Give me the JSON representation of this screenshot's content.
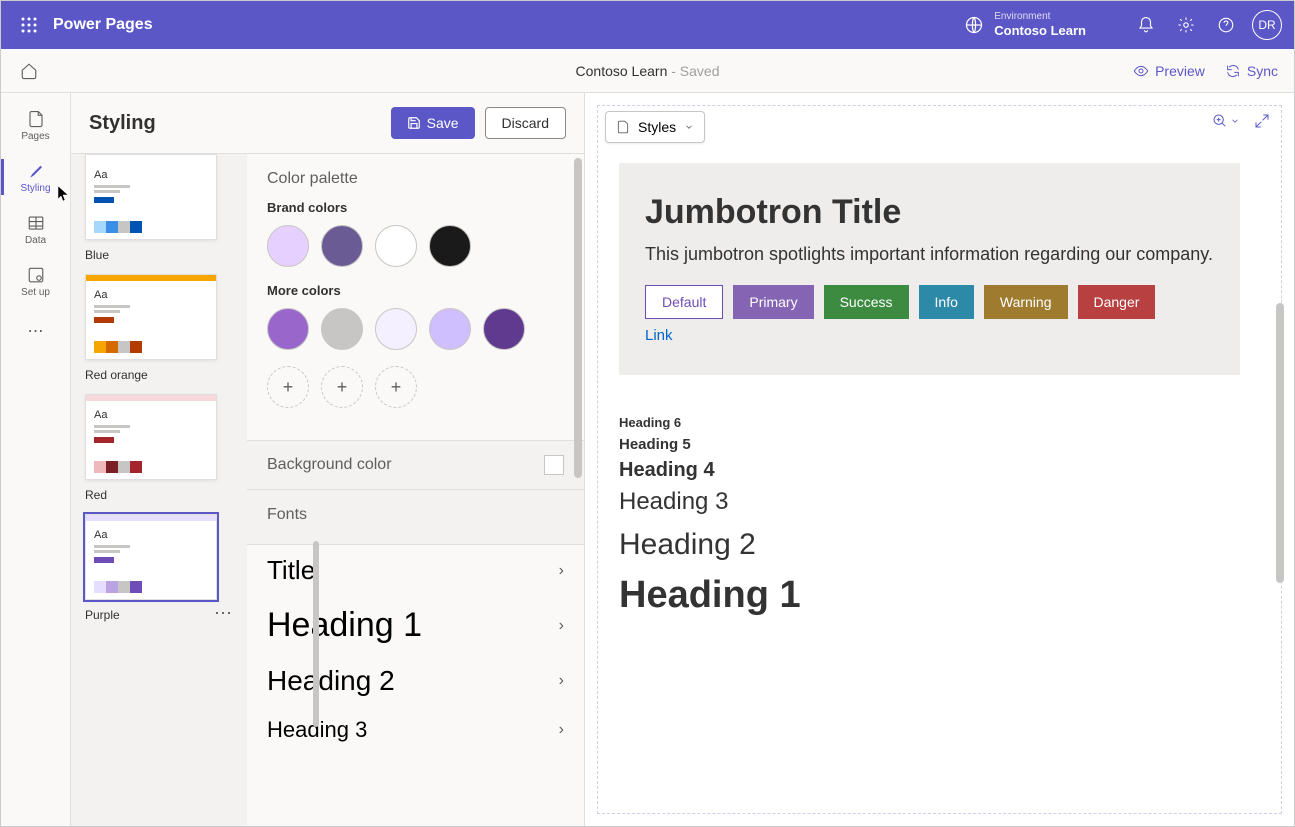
{
  "header": {
    "app_title": "Power Pages",
    "env_label": "Environment",
    "env_name": "Contoso Learn",
    "avatar_initials": "DR"
  },
  "command_bar": {
    "site_name": "Contoso Learn",
    "status": " - Saved",
    "preview": "Preview",
    "sync": "Sync"
  },
  "nav": {
    "items": [
      {
        "label": "Pages"
      },
      {
        "label": "Styling"
      },
      {
        "label": "Data"
      },
      {
        "label": "Set up"
      }
    ]
  },
  "styling": {
    "title": "Styling",
    "save": "Save",
    "discard": "Discard",
    "themes": [
      {
        "label": "Blue",
        "band": "#ffffff",
        "accent": "#0052b3",
        "sw": [
          "#a6d8ff",
          "#3a8ee6",
          "#c8c6c4",
          "#0052b3"
        ]
      },
      {
        "label": "Red orange",
        "band": "#f7a500",
        "accent": "#b33a00",
        "sw": [
          "#f7a500",
          "#d46a00",
          "#c8c6c4",
          "#b33a00"
        ]
      },
      {
        "label": "Red",
        "band": "#f8d7da",
        "accent": "#a4262c",
        "sw": [
          "#efb9bc",
          "#7a1f23",
          "#c8c6c4",
          "#a4262c"
        ]
      },
      {
        "label": "Purple",
        "band": "#e6deff",
        "accent": "#6f4db8",
        "sw": [
          "#e6deff",
          "#b9a3e3",
          "#c8c6c4",
          "#6f4db8"
        ]
      }
    ],
    "color_palette": {
      "title": "Color palette",
      "brand_label": "Brand colors",
      "brand": [
        "#e6d0ff",
        "#6b5b95",
        "#ffffff",
        "#1a1a1a"
      ],
      "more_label": "More colors",
      "more": [
        "#9966cc",
        "#c8c6c4",
        "#f5f0ff",
        "#d0bfff",
        "#5f3a8f"
      ]
    },
    "background": {
      "title": "Background color"
    },
    "fonts": {
      "title": "Fonts",
      "rows": [
        "Title",
        "Heading 1",
        "Heading 2",
        "Heading 3"
      ]
    }
  },
  "preview": {
    "styles_dd": "Styles",
    "jumbo_title": "Jumbotron Title",
    "jumbo_text": "This jumbotron spotlights important information regarding our company.",
    "buttons": {
      "default": "Default",
      "primary": "Primary",
      "success": "Success",
      "info": "Info",
      "warning": "Warning",
      "danger": "Danger"
    },
    "link": "Link",
    "headings": {
      "h6": "Heading 6",
      "h5": "Heading 5",
      "h4": "Heading 4",
      "h3": "Heading 3",
      "h2": "Heading 2",
      "h1": "Heading 1"
    }
  }
}
